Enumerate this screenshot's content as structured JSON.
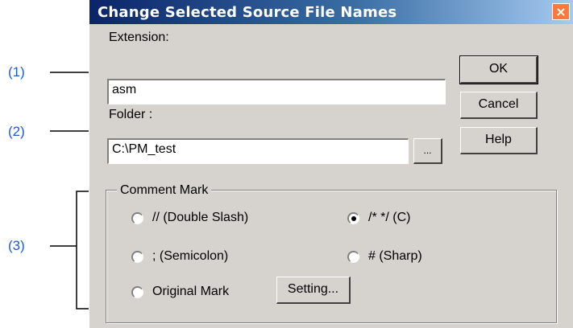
{
  "callouts": {
    "c1": "(1)",
    "c2": "(2)",
    "c3": "(3)"
  },
  "dialog": {
    "title": "Change Selected Source File Names",
    "close_glyph": "×"
  },
  "extension": {
    "label": "Extension:",
    "value": "asm"
  },
  "folder": {
    "label": "Folder :",
    "value": "C:\\PM_test",
    "browse_label": "..."
  },
  "buttons": {
    "ok": "OK",
    "cancel": "Cancel",
    "help": "Help"
  },
  "comment_mark": {
    "title": "Comment Mark",
    "options": [
      {
        "label": "// (Double Slash)",
        "selected": false
      },
      {
        "label": "/* */ (C)",
        "selected": true
      },
      {
        "label": "; (Semicolon)",
        "selected": false
      },
      {
        "label": "# (Sharp)",
        "selected": false
      },
      {
        "label": "Original Mark",
        "selected": false
      }
    ],
    "setting_label": "Setting..."
  },
  "colors": {
    "title_start": "#0a246a",
    "title_end": "#a6caf0",
    "callout": "#1f5bd6",
    "face": "#d6d3ce"
  }
}
